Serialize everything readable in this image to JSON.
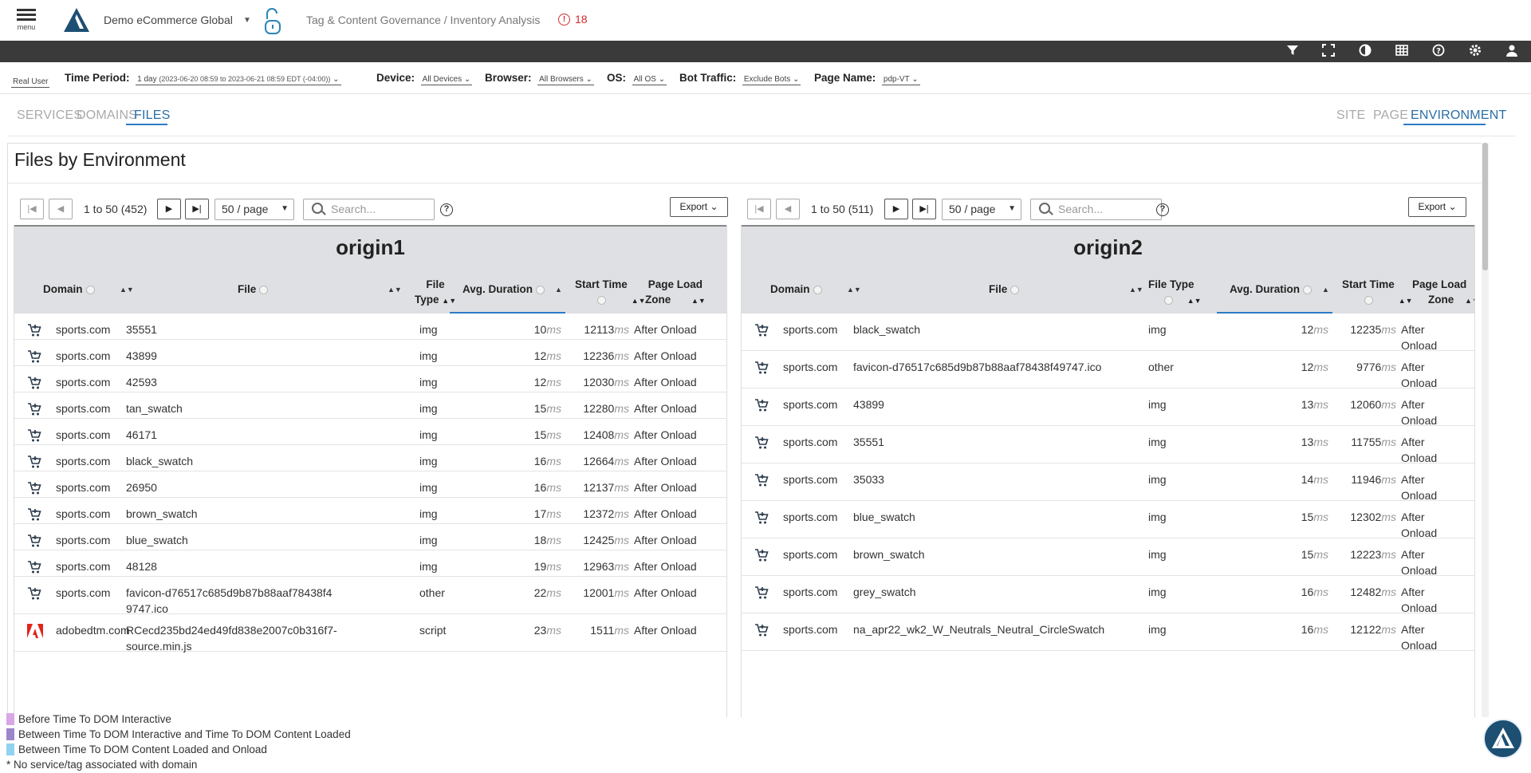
{
  "header": {
    "menu_label": "menu",
    "app_name": "Demo eCommerce Global",
    "breadcrumb": "Tag & Content Governance / Inventory Analysis",
    "alert_count": "18"
  },
  "filters": {
    "mode": "Real User",
    "time_period_label": "Time Period:",
    "time_period_value": "1 day",
    "time_period_range": "(2023-06-20 08:59 to 2023-06-21 08:59 EDT (-04:00))",
    "device_label": "Device:",
    "device_value": "All Devices",
    "browser_label": "Browser:",
    "browser_value": "All Browsers",
    "os_label": "OS:",
    "os_value": "All OS",
    "bot_label": "Bot Traffic:",
    "bot_value": "Exclude Bots",
    "page_label": "Page Name:",
    "page_value": "pdp-VT"
  },
  "tabs_left": [
    "SERVICES",
    "DOMAINS",
    "FILES"
  ],
  "tabs_right": [
    "SITE",
    "PAGE",
    "ENVIRONMENT"
  ],
  "panel_title": "Files by Environment",
  "tables": [
    {
      "title": "origin1",
      "range": "1 to 50 (452)",
      "page_size": "50 / page",
      "search_placeholder": "Search...",
      "export_label": "Export",
      "columns": {
        "domain": "Domain",
        "file": "File",
        "file_type_1": "File",
        "file_type_2": "Type",
        "avg": "Avg. Duration",
        "start": "Start Time",
        "zone_1": "Page Load",
        "zone_2": "Zone"
      },
      "rows": [
        {
          "icon": "cart",
          "domain": "sports.com",
          "file": "35551",
          "type": "img",
          "avg": "10",
          "start": "12113",
          "zone": "After Onload"
        },
        {
          "icon": "cart",
          "domain": "sports.com",
          "file": "43899",
          "type": "img",
          "avg": "12",
          "start": "12236",
          "zone": "After Onload"
        },
        {
          "icon": "cart",
          "domain": "sports.com",
          "file": "42593",
          "type": "img",
          "avg": "12",
          "start": "12030",
          "zone": "After Onload"
        },
        {
          "icon": "cart",
          "domain": "sports.com",
          "file": "tan_swatch",
          "type": "img",
          "avg": "15",
          "start": "12280",
          "zone": "After Onload"
        },
        {
          "icon": "cart",
          "domain": "sports.com",
          "file": "46171",
          "type": "img",
          "avg": "15",
          "start": "12408",
          "zone": "After Onload"
        },
        {
          "icon": "cart",
          "domain": "sports.com",
          "file": "black_swatch",
          "type": "img",
          "avg": "16",
          "start": "12664",
          "zone": "After Onload"
        },
        {
          "icon": "cart",
          "domain": "sports.com",
          "file": "26950",
          "type": "img",
          "avg": "16",
          "start": "12137",
          "zone": "After Onload"
        },
        {
          "icon": "cart",
          "domain": "sports.com",
          "file": "brown_swatch",
          "type": "img",
          "avg": "17",
          "start": "12372",
          "zone": "After Onload"
        },
        {
          "icon": "cart",
          "domain": "sports.com",
          "file": "blue_swatch",
          "type": "img",
          "avg": "18",
          "start": "12425",
          "zone": "After Onload"
        },
        {
          "icon": "cart",
          "domain": "sports.com",
          "file": "48128",
          "type": "img",
          "avg": "19",
          "start": "12963",
          "zone": "After Onload"
        },
        {
          "icon": "cart",
          "domain": "sports.com",
          "file": "favicon-d76517c685d9b87b88aaf78438f49747.ico",
          "type": "other",
          "avg": "22",
          "start": "12001",
          "zone": "After Onload"
        },
        {
          "icon": "adobe",
          "domain": "adobedtm.com",
          "file": "RCecd235bd24ed49fd838e2007c0b316f7-source.min.js",
          "type": "script",
          "avg": "23",
          "start": "1511",
          "zone": "After Onload"
        }
      ]
    },
    {
      "title": "origin2",
      "range": "1 to 50 (511)",
      "page_size": "50 / page",
      "search_placeholder": "Search...",
      "export_label": "Export",
      "columns": {
        "domain": "Domain",
        "file": "File",
        "file_type_1": "File Type",
        "file_type_2": "",
        "avg": "Avg. Duration",
        "start": "Start Time",
        "zone_1": "Page Load",
        "zone_2": "Zone"
      },
      "rows": [
        {
          "icon": "cart",
          "domain": "sports.com",
          "file": "black_swatch",
          "type": "img",
          "avg": "12",
          "start": "12235",
          "zone": "After Onload"
        },
        {
          "icon": "cart",
          "domain": "sports.com",
          "file": "favicon-d76517c685d9b87b88aaf78438f49747.ico",
          "type": "other",
          "avg": "12",
          "start": "9776",
          "zone": "After Onload"
        },
        {
          "icon": "cart",
          "domain": "sports.com",
          "file": "43899",
          "type": "img",
          "avg": "13",
          "start": "12060",
          "zone": "After Onload"
        },
        {
          "icon": "cart",
          "domain": "sports.com",
          "file": "35551",
          "type": "img",
          "avg": "13",
          "start": "11755",
          "zone": "After Onload"
        },
        {
          "icon": "cart",
          "domain": "sports.com",
          "file": "35033",
          "type": "img",
          "avg": "14",
          "start": "11946",
          "zone": "After Onload"
        },
        {
          "icon": "cart",
          "domain": "sports.com",
          "file": "blue_swatch",
          "type": "img",
          "avg": "15",
          "start": "12302",
          "zone": "After Onload"
        },
        {
          "icon": "cart",
          "domain": "sports.com",
          "file": "brown_swatch",
          "type": "img",
          "avg": "15",
          "start": "12223",
          "zone": "After Onload"
        },
        {
          "icon": "cart",
          "domain": "sports.com",
          "file": "grey_swatch",
          "type": "img",
          "avg": "16",
          "start": "12482",
          "zone": "After Onload"
        },
        {
          "icon": "cart",
          "domain": "sports.com",
          "file": "na_apr22_wk2_W_Neutrals_Neutral_CircleSwatch",
          "type": "img",
          "avg": "16",
          "start": "12122",
          "zone": "After Onload"
        }
      ]
    }
  ],
  "unit": "ms",
  "legend": [
    {
      "label": "Before Time To DOM Interactive",
      "color": "#d9a7e6"
    },
    {
      "label": "Between Time To DOM Interactive and Time To DOM Content Loaded",
      "color": "#9b86c9"
    },
    {
      "label": "Between Time To DOM Content Loaded and Onload",
      "color": "#8fd3ef"
    }
  ],
  "legend_note": "* No service/tag associated with domain",
  "colors": {
    "accent": "#2b7bc4",
    "toolbar": "#3a3a3a",
    "alert": "#d12b2b"
  }
}
